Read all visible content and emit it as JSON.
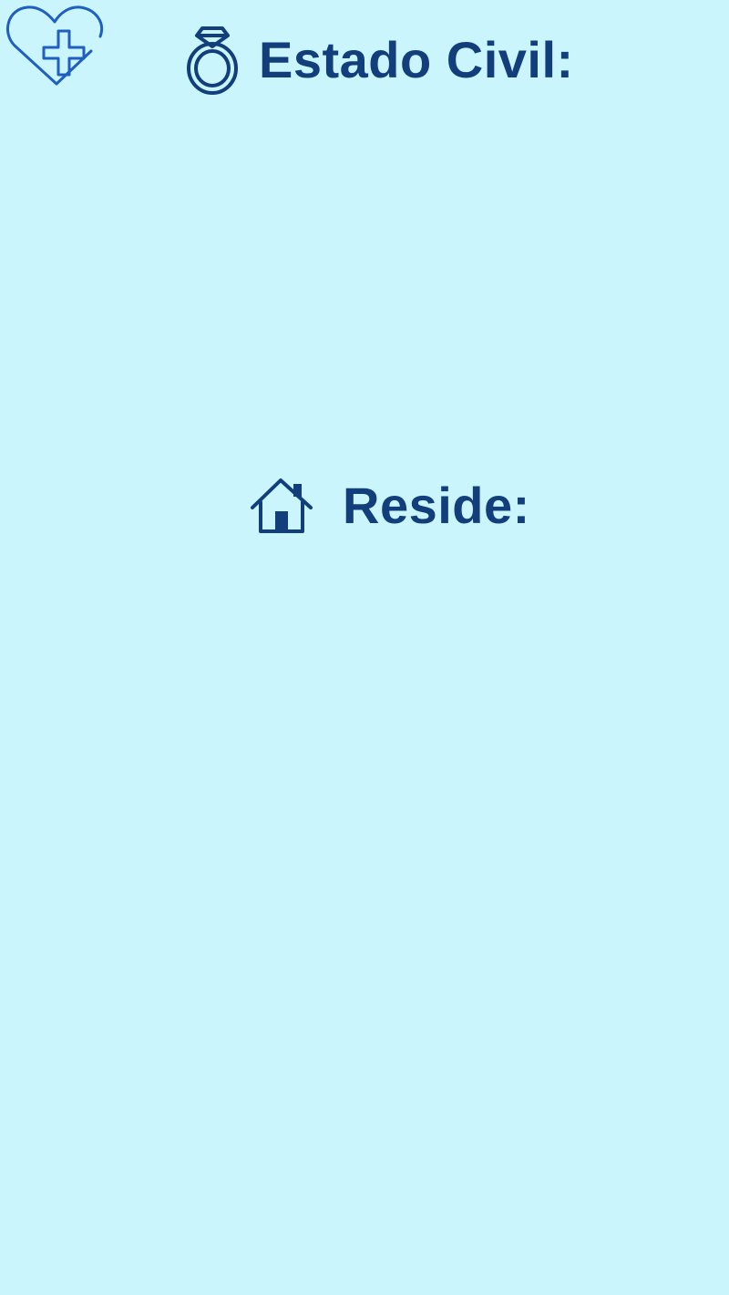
{
  "app": {
    "logo_icon": "heart-plus-icon"
  },
  "fields": {
    "estado_civil": {
      "label": "Estado Civil:",
      "icon": "ring-icon"
    },
    "reside": {
      "label": "Reside:",
      "icon": "house-icon"
    }
  },
  "colors": {
    "background": "#cbf5fd",
    "label_text": "#123f7c",
    "logo_stroke": "#1f5fbf"
  }
}
